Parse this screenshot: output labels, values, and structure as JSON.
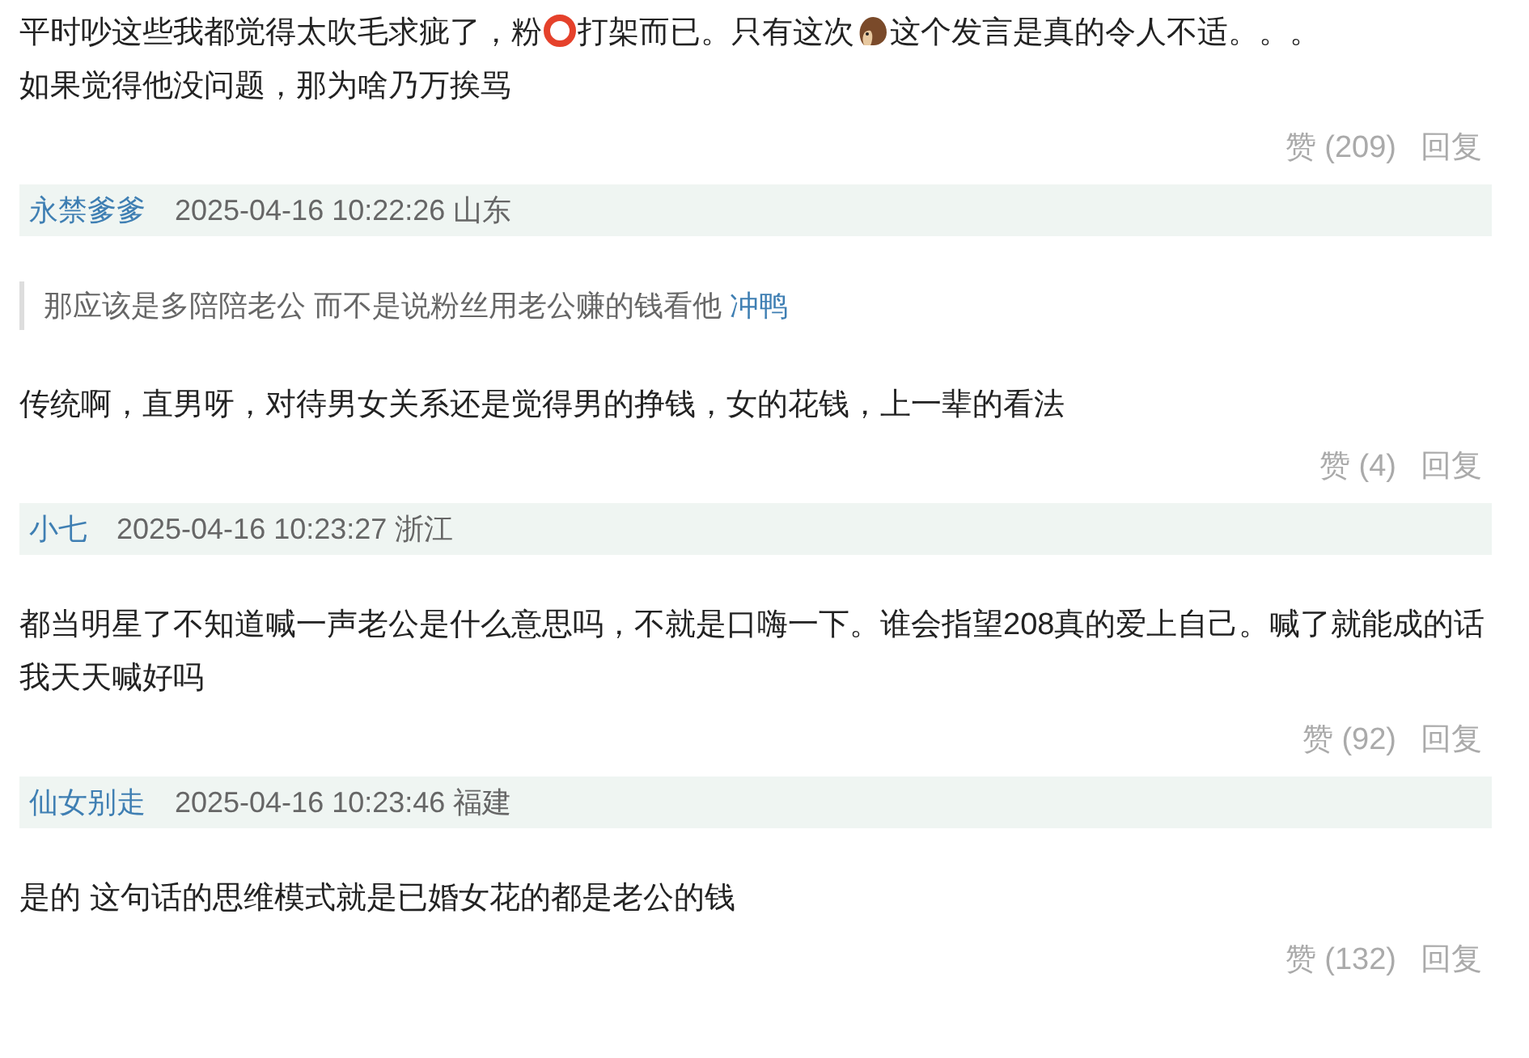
{
  "comments": [
    {
      "body": [
        {
          "kind": "text",
          "text": "平时吵这些我都觉得太吹毛求疵了，粉"
        },
        {
          "kind": "ring"
        },
        {
          "kind": "text",
          "text": "打架而已。只有这次"
        },
        {
          "kind": "hedgehog"
        },
        {
          "kind": "text",
          "text": "这个发言是真的令人不适。。。"
        },
        {
          "kind": "break"
        },
        {
          "kind": "text",
          "text": "如果觉得他没问题，那为啥乃万挨骂"
        }
      ],
      "likes": "赞 (209)",
      "reply": "回复"
    },
    {
      "user": "永禁爹爹",
      "time": "2025-04-16 10:22:26",
      "region": "山东",
      "quote": {
        "text": "那应该是多陪陪老公 而不是说粉丝用老公赚的钱看他",
        "author": "冲鸭"
      },
      "body": [
        {
          "kind": "text",
          "text": "传统啊，直男呀，对待男女关系还是觉得男的挣钱，女的花钱，上一辈的看法"
        }
      ],
      "likes": "赞 (4)",
      "reply": "回复"
    },
    {
      "user": "小七",
      "time": "2025-04-16 10:23:27",
      "region": "浙江",
      "body": [
        {
          "kind": "text",
          "text": "都当明星了不知道喊一声老公是什么意思吗，不就是口嗨一下。谁会指望208真的爱上自己。喊了就能成的话我天天喊好吗"
        }
      ],
      "likes": "赞 (92)",
      "reply": "回复"
    },
    {
      "user": "仙女别走",
      "time": "2025-04-16 10:23:46",
      "region": "福建",
      "body": [
        {
          "kind": "text",
          "text": "是的 这句话的思维模式就是已婚女花的都是老公的钱"
        }
      ],
      "likes": "赞 (132)",
      "reply": "回复"
    }
  ]
}
